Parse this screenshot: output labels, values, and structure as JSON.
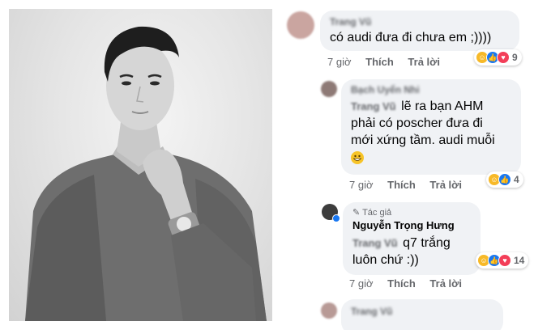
{
  "comments": [
    {
      "name": "Trang Vũ",
      "text": "có audi đưa đi chưa em ;))))",
      "time": "7 giờ",
      "like": "Thích",
      "reply": "Trả lời",
      "reactions": {
        "icons": [
          "haha-icon",
          "like-icon",
          "love-icon"
        ],
        "count": "9"
      }
    },
    {
      "name": "Bạch Uyển Nhi",
      "tag": "Trang Vũ",
      "text_line1": "lẽ ra bạn AHM",
      "text_line2": "phải có poscher đưa đi",
      "text_line3": "mới xứng tầm. audi muỗi",
      "emoji": "grinning-emoji",
      "time": "7 giờ",
      "like": "Thích",
      "reply": "Trả lời",
      "reactions": {
        "icons": [
          "haha-icon",
          "like-icon"
        ],
        "count": "4"
      }
    },
    {
      "badge": "Tác giả",
      "name": "Nguyễn Trọng Hưng",
      "tag": "Trang Vũ",
      "text_line1": "q7 trắng",
      "text_line2": "luôn chứ :))",
      "time": "7 giờ",
      "like": "Thích",
      "reply": "Trả lời",
      "reactions": {
        "icons": [
          "haha-icon",
          "like-icon",
          "love-icon"
        ],
        "count": "14"
      }
    },
    {
      "name": "Trang Vũ"
    }
  ],
  "colors": {
    "bubble": "#f0f2f5",
    "meta": "#65676b",
    "like_blue": "#1877f2",
    "love_red": "#f33e58",
    "haha_yellow": "#f7b928"
  }
}
